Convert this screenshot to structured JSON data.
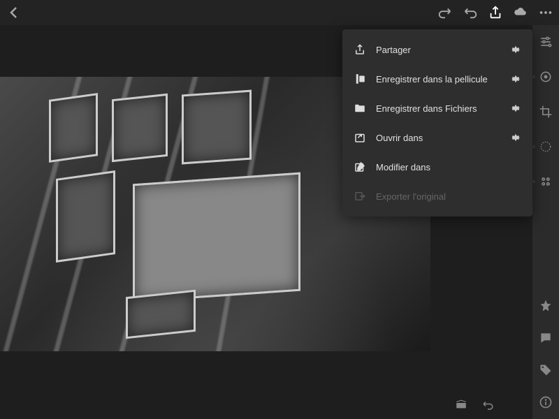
{
  "share_menu": {
    "items": [
      {
        "label": "Partager",
        "icon": "share-icon",
        "has_gear": true,
        "enabled": true
      },
      {
        "label": "Enregistrer dans la pellicule",
        "icon": "filmstrip-icon",
        "has_gear": true,
        "enabled": true
      },
      {
        "label": "Enregistrer dans Fichiers",
        "icon": "folder-icon",
        "has_gear": true,
        "enabled": true
      },
      {
        "label": "Ouvrir dans",
        "icon": "open-in-icon",
        "has_gear": true,
        "enabled": true
      },
      {
        "label": "Modifier dans",
        "icon": "edit-in-icon",
        "has_gear": false,
        "enabled": true
      },
      {
        "label": "Exporter l'original",
        "icon": "export-icon",
        "has_gear": false,
        "enabled": false
      }
    ]
  },
  "topbar": {
    "icons": [
      "redo-icon",
      "undo-icon",
      "share-icon",
      "cloud-icon",
      "more-icon"
    ]
  },
  "right_panel": {
    "top_icons": [
      "sliders-icon",
      "healing-icon",
      "crop-icon",
      "radial-icon",
      "presets-icon"
    ],
    "bottom_icons": [
      "star-icon",
      "comment-icon",
      "tag-icon",
      "info-icon"
    ]
  },
  "bottom_toolbar": {
    "icons": [
      "filmstrip-toggle-icon",
      "reset-icon"
    ]
  },
  "colors": {
    "bg": "#1a1a1a",
    "panel": "#2b2b2b",
    "menu": "#2e2e2e",
    "text": "#e0e0e0",
    "muted": "#888"
  }
}
